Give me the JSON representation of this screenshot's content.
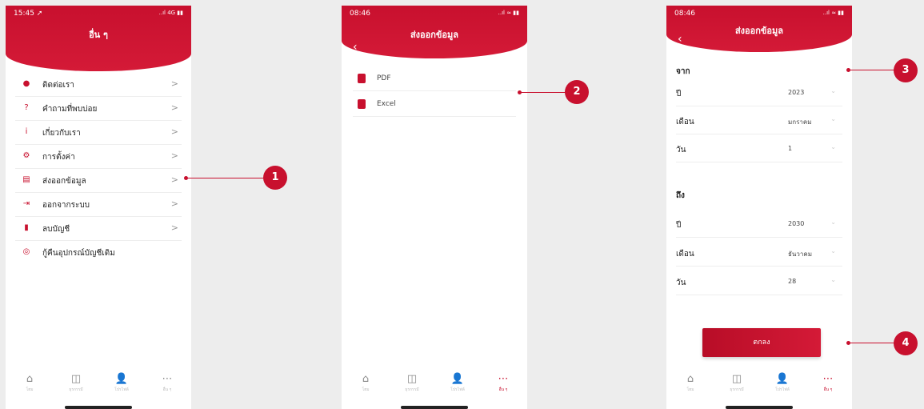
{
  "screen1": {
    "status_time": "15:45 ➚",
    "status_right": "..ıl 4G ▮▮",
    "title": "อื่น ๆ",
    "menu": [
      {
        "label": "ติดต่อเรา",
        "icon": "person-icon",
        "glyph": "●"
      },
      {
        "label": "คำถามที่พบบ่อย",
        "icon": "question-icon",
        "glyph": "?"
      },
      {
        "label": "เกี่ยวกับเรา",
        "icon": "info-icon",
        "glyph": "i"
      },
      {
        "label": "การตั้งค่า",
        "icon": "gear-icon",
        "glyph": "⚙"
      },
      {
        "label": "ส่งออกข้อมูล",
        "icon": "document-icon",
        "glyph": "▤"
      },
      {
        "label": "ออกจากระบบ",
        "icon": "logout-icon",
        "glyph": "⇥"
      },
      {
        "label": "ลบบัญชี",
        "icon": "trash-icon",
        "glyph": "▮"
      },
      {
        "label": "กู้คืนอุปกรณ์บัญชีเดิม",
        "icon": "restore-icon",
        "glyph": "◎"
      }
    ],
    "tabs": [
      {
        "label": "โฮม",
        "icon": "home-icon",
        "glyph": "⌂"
      },
      {
        "label": "ธุรกรรมี",
        "icon": "wallet-icon",
        "glyph": "◫"
      },
      {
        "label": "โปรไฟล์",
        "icon": "profile-icon",
        "glyph": "👤"
      },
      {
        "label": "อื่น ๆ",
        "icon": "more-icon",
        "glyph": "⋯"
      }
    ]
  },
  "screen2": {
    "status_time": "08:46",
    "status_right": "..ıl ≈ ▮▮",
    "title": "ส่งออกข้อมูล",
    "back": "‹",
    "items": [
      {
        "label": "PDF",
        "icon": "pdf-file-icon"
      },
      {
        "label": "Excel",
        "icon": "excel-file-icon"
      }
    ]
  },
  "screen3": {
    "status_time": "08:46",
    "status_right": "..ıl ≈ ▮▮",
    "title": "ส่งออกข้อมูล",
    "back": "‹",
    "from_label": "จาก",
    "to_label": "ถึง",
    "from": [
      {
        "label": "ปี",
        "value": "2023"
      },
      {
        "label": "เดือน",
        "value": "มกราคม"
      },
      {
        "label": "วัน",
        "value": "1"
      }
    ],
    "to": [
      {
        "label": "ปี",
        "value": "2030"
      },
      {
        "label": "เดือน",
        "value": "ธันวาคม"
      },
      {
        "label": "วัน",
        "value": "28"
      }
    ],
    "ok_label": "ตกลง"
  },
  "chevron": ">",
  "dropdown_chevron": "⌄",
  "callouts": [
    "1",
    "2",
    "3",
    "4"
  ],
  "colors": {
    "brand": "#c8102e"
  }
}
